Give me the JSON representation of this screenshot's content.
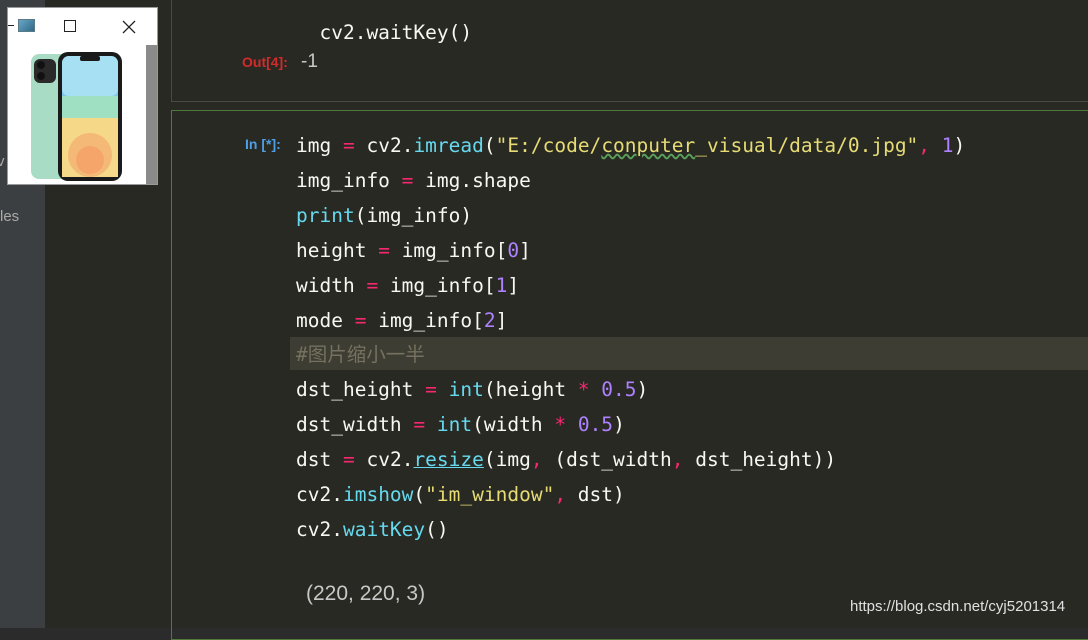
{
  "sidebar": {
    "partial_text_1": "v",
    "partial_text_2": "les"
  },
  "prev_cell": {
    "code_tail": "cv2.waitKey()",
    "out_prompt": "Out[4]:",
    "out_value": "-1"
  },
  "current_cell": {
    "in_prompt": "In [*]:",
    "lines": {
      "l1": {
        "a": "img",
        "b": " = ",
        "c": "cv2.",
        "d": "imread",
        "e": "(",
        "f": "\"E:/code/",
        "g": "conputer",
        "h": "_visual/data/0.jpg\"",
        "i": ", ",
        "j": "1",
        "k": ")"
      },
      "l2": {
        "a": "img_info",
        "b": " = ",
        "c": "img.shape"
      },
      "l3": {
        "a": "print",
        "b": "(img_info)"
      },
      "l4": {
        "a": "height",
        "b": " = ",
        "c": "img_info[",
        "d": "0",
        "e": "]"
      },
      "l5": {
        "a": "width",
        "b": " = ",
        "c": "img_info[",
        "d": "1",
        "e": "]"
      },
      "l6": {
        "a": "mode",
        "b": " = ",
        "c": "img_info[",
        "d": "2",
        "e": "]"
      },
      "l7": {
        "a": "#图片缩小一半"
      },
      "l8": {
        "a": "dst_height",
        "b": " = ",
        "c": "int",
        "d": "(height ",
        "e": "*",
        "f": " ",
        "g": "0.5",
        "h": ")"
      },
      "l9": {
        "a": "dst_width",
        "b": " = ",
        "c": "int",
        "d": "(width ",
        "e": "*",
        "f": " ",
        "g": "0.5",
        "h": ")"
      },
      "l10": {
        "a": "dst",
        "b": " = ",
        "c": "cv2.",
        "d": "resize",
        "e": "(img",
        "f": ", ",
        "g": "(dst_width",
        "h": ", ",
        "i": "dst_height))"
      },
      "l11": {
        "a": "cv2.",
        "b": "imshow",
        "c": "(",
        "d": "\"im_window\"",
        "e": ", ",
        "f": "dst)"
      },
      "l12": {
        "a": "cv2.",
        "b": "waitKey",
        "c": "()"
      }
    },
    "output": "(220, 220, 3)"
  },
  "image_window": {
    "app_icon": "image-app-icon",
    "minimize": "minimize-icon",
    "maximize": "maximize-icon",
    "close": "close-icon",
    "picture": "green-smartphone"
  },
  "watermark": "https://blog.csdn.net/cyj5201314",
  "colors": {
    "background": "#282923",
    "keyword": "#66d9ef",
    "operator": "#f92672",
    "number": "#ae81ff",
    "string": "#e6db74",
    "comment": "#75715e",
    "in_prompt": "#4d9ee6",
    "out_prompt": "#d52a2a"
  }
}
